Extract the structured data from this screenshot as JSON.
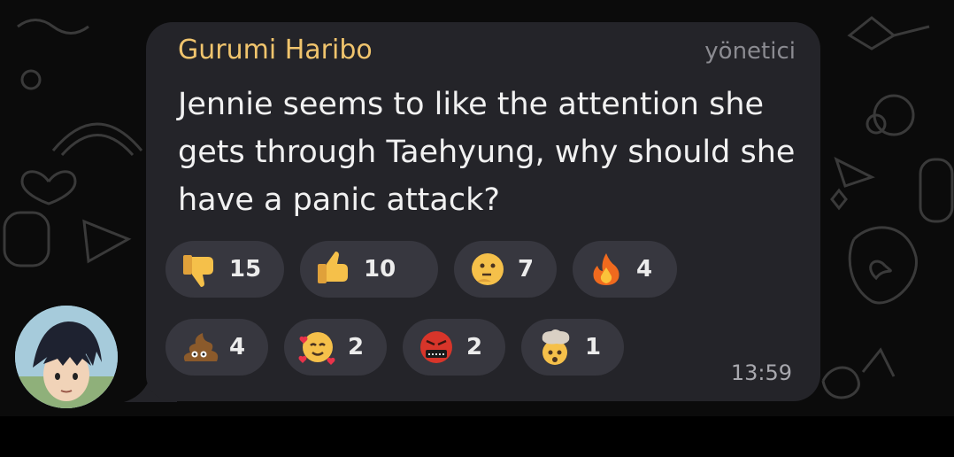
{
  "message": {
    "sender": "Gurumi Haribo",
    "role": "yönetici",
    "text": "Jennie seems to like the attention she gets through Taehyung, why should she have a panic attack?",
    "time": "13:59"
  },
  "reactions": [
    {
      "icon": "thumbs-down-icon",
      "count": "15"
    },
    {
      "icon": "thumbs-up-icon",
      "count": "10"
    },
    {
      "icon": "thinking-face-icon",
      "count": "7"
    },
    {
      "icon": "fire-icon",
      "count": "4"
    },
    {
      "icon": "poop-icon",
      "count": "4"
    },
    {
      "icon": "smiling-face-with-hearts-icon",
      "count": "2"
    },
    {
      "icon": "face-with-symbols-on-mouth-icon",
      "count": "2"
    },
    {
      "icon": "exploding-head-icon",
      "count": "1"
    }
  ],
  "colors": {
    "background": "#0b0b0b",
    "bubble": "#242429",
    "sender": "#f0c46d",
    "reaction_pill": "#37373f"
  }
}
